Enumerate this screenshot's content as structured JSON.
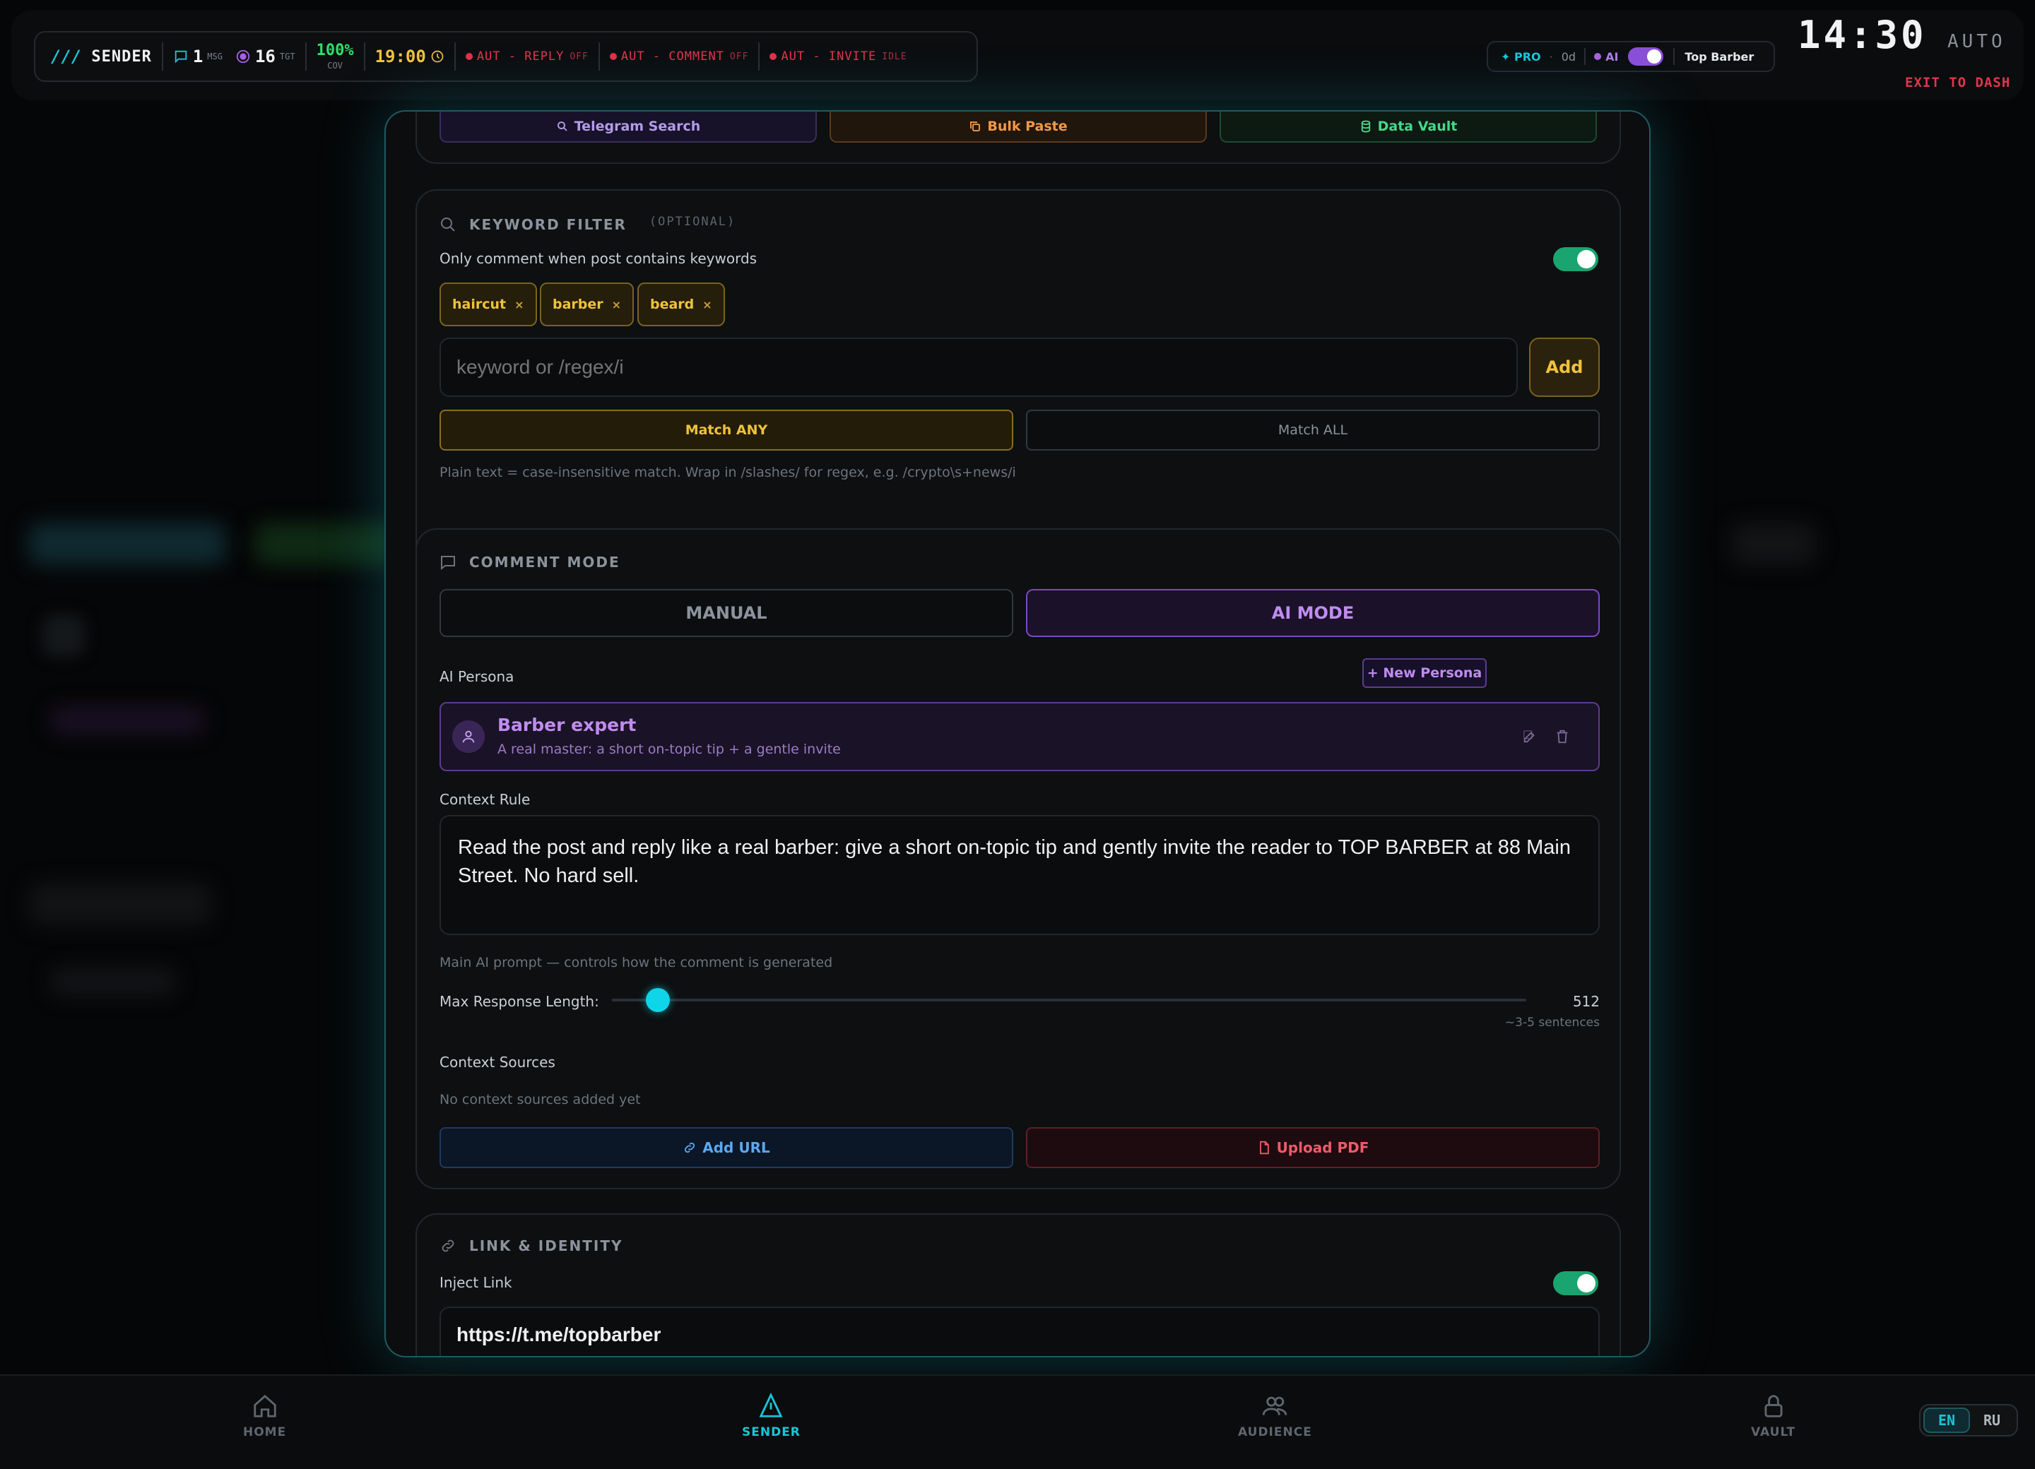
{
  "header": {
    "logo_mark": "///",
    "app_name": "SENDER",
    "msg_count": "1",
    "msg_label": "MSG",
    "tgt_count": "16",
    "tgt_label": "TGT",
    "cov_value": "100%",
    "cov_label": "COV",
    "time_value": "19:00",
    "auto_reply_label": "AUT - REPLY",
    "auto_reply_state": "OFF",
    "auto_comment_label": "AUT - COMMENT",
    "auto_comment_state": "OFF",
    "auto_invite_label": "AUT - INVITE",
    "auto_invite_state": "IDLE",
    "pro_label": "✦ PRO",
    "days_label": "0d",
    "ai_label": "AI",
    "workspace_name": "Top Barber",
    "clock": "14:30",
    "mode": "AUTO",
    "exit_label": "EXIT TO DASH"
  },
  "sources": {
    "telegram_search": "Telegram Search",
    "bulk_paste": "Bulk Paste",
    "data_vault": "Data Vault"
  },
  "keyword_filter": {
    "title": "KEYWORD FILTER",
    "optional_label": "(OPTIONAL)",
    "toggle_label": "Only comment when post contains keywords",
    "toggle_on": true,
    "chips": [
      "haircut",
      "barber",
      "beard"
    ],
    "chip_remove": "×",
    "input_placeholder": "keyword or /regex/i",
    "add_label": "Add",
    "match_any_label": "Match ANY",
    "match_all_label": "Match ALL",
    "hint": "Plain text = case-insensitive match. Wrap in /slashes/ for regex, e.g. /crypto\\s+news/i"
  },
  "comment_mode": {
    "title": "COMMENT MODE",
    "manual_label": "MANUAL",
    "ai_mode_label": "AI MODE",
    "persona_label": "AI Persona",
    "new_persona_label": "+ New Persona",
    "persona_name": "Barber expert",
    "persona_desc": "A real master: a short on-topic tip + a gentle invite",
    "context_rule_label": "Context Rule",
    "context_rule_text": "Read the post and reply like a real barber: give a short on-topic tip and gently invite the reader to TOP BARBER at 88 Main Street. No hard sell.",
    "context_rule_hint": "Main AI prompt — controls how the comment is generated",
    "max_length_label": "Max Response Length:",
    "max_length_value": "512",
    "max_length_fraction": 0.05,
    "max_length_note": "~3-5 sentences",
    "context_sources_label": "Context Sources",
    "no_sources_text": "No context sources added yet",
    "add_url_label": "Add URL",
    "upload_pdf_label": "Upload PDF"
  },
  "link_identity": {
    "title": "LINK & IDENTITY",
    "inject_label": "Inject Link",
    "inject_on": true,
    "link_value": "https://t.me/topbarber"
  },
  "nav": {
    "home": "HOME",
    "sender": "SENDER",
    "audience": "AUDIENCE",
    "vault": "VAULT",
    "active": "sender"
  },
  "lang": {
    "en": "EN",
    "ru": "RU",
    "active": "EN"
  },
  "colors": {
    "accent": "#0fd5e8",
    "amber": "#f0c23c",
    "purple": "#b07be8",
    "green": "#1aa470",
    "red": "#e0354b"
  }
}
